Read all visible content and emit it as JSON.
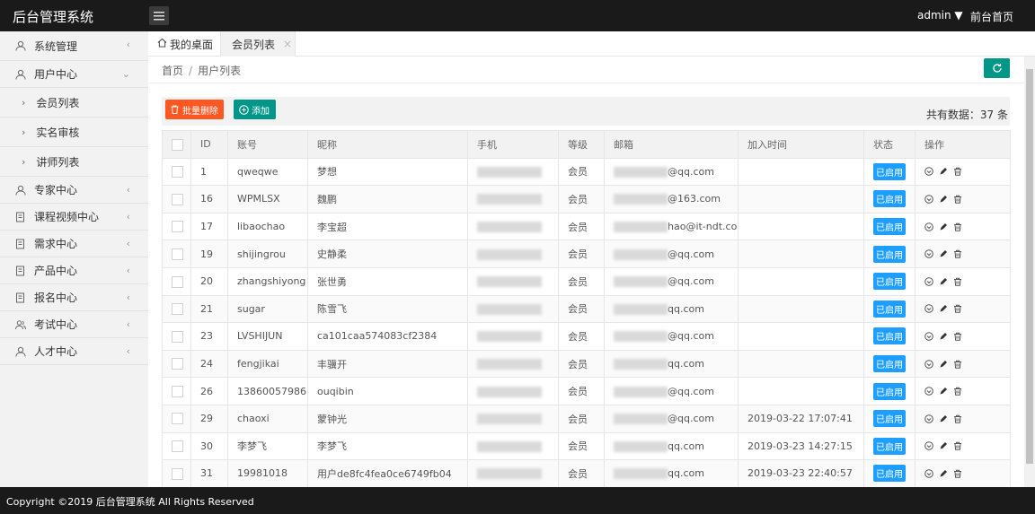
{
  "app": {
    "brand": "后台管理系统",
    "admin_label": "admin ▼",
    "front_link": "前台首页"
  },
  "sidebar": {
    "items": [
      {
        "label": "系统管理",
        "icon": "user-icon",
        "arrow": "‹"
      },
      {
        "label": "用户中心",
        "icon": "user-icon",
        "arrow": "⌄"
      },
      {
        "label": "专家中心",
        "icon": "user-icon",
        "arrow": "‹"
      },
      {
        "label": "课程视频中心",
        "icon": "document-icon",
        "arrow": "‹"
      },
      {
        "label": "需求中心",
        "icon": "document-icon",
        "arrow": "‹"
      },
      {
        "label": "产品中心",
        "icon": "document-icon",
        "arrow": "‹"
      },
      {
        "label": "报名中心",
        "icon": "document-icon",
        "arrow": "‹"
      },
      {
        "label": "考试中心",
        "icon": "users-icon",
        "arrow": "‹"
      },
      {
        "label": "人才中心",
        "icon": "user-icon",
        "arrow": "‹"
      }
    ],
    "subitems": [
      {
        "label": "会员列表"
      },
      {
        "label": "实名审核"
      },
      {
        "label": "讲师列表"
      }
    ]
  },
  "tabs": [
    {
      "label": "我的桌面",
      "icon": "home-icon"
    },
    {
      "label": "会员列表",
      "close": "×"
    }
  ],
  "breadcrumb": {
    "home": "首页",
    "sep": "/",
    "current": "用户列表"
  },
  "toolbar": {
    "delete_label": "批量删除",
    "add_label": "添加",
    "total_text": "共有数据：37 条"
  },
  "table": {
    "headers": [
      "",
      "ID",
      "账号",
      "昵称",
      "手机",
      "等级",
      "邮箱",
      "加入时间",
      "状态",
      "操作"
    ],
    "rows": [
      {
        "id": "1",
        "account": "qweqwe",
        "nickname": "梦想",
        "level": "会员",
        "email": "@qq.com",
        "joined": "",
        "status": "已启用"
      },
      {
        "id": "16",
        "account": "WPMLSX",
        "nickname": "魏鹏",
        "level": "会员",
        "email": "@163.com",
        "joined": "",
        "status": "已启用"
      },
      {
        "id": "17",
        "account": "libaochao",
        "nickname": "李宝超",
        "level": "会员",
        "email": "hao@it-ndt.com",
        "joined": "",
        "status": "已启用"
      },
      {
        "id": "19",
        "account": "shijingrou",
        "nickname": "史静柔",
        "level": "会员",
        "email": "@qq.com",
        "joined": "",
        "status": "已启用"
      },
      {
        "id": "20",
        "account": "zhangshiyong",
        "nickname": "张世勇",
        "level": "会员",
        "email": "@qq.com",
        "joined": "",
        "status": "已启用"
      },
      {
        "id": "21",
        "account": "sugar",
        "nickname": "陈雪飞",
        "level": "会员",
        "email": "qq.com",
        "joined": "",
        "status": "已启用"
      },
      {
        "id": "23",
        "account": "LVSHIJUN",
        "nickname": "ca101caa574083cf2384",
        "level": "会员",
        "email": "@qq.com",
        "joined": "",
        "status": "已启用"
      },
      {
        "id": "24",
        "account": "fengjikai",
        "nickname": "丰骥开",
        "level": "会员",
        "email": "qq.com",
        "joined": "",
        "status": "已启用"
      },
      {
        "id": "26",
        "account": "13860057986",
        "nickname": "ouqibin",
        "level": "会员",
        "email": "@qq.com",
        "joined": "",
        "status": "已启用"
      },
      {
        "id": "29",
        "account": "chaoxi",
        "nickname": "蒙钟光",
        "level": "会员",
        "email": "@qq.com",
        "joined": "2019-03-22 17:07:41",
        "status": "已启用"
      },
      {
        "id": "30",
        "account": "李梦飞",
        "nickname": "李梦飞",
        "level": "会员",
        "email": "qq.com",
        "joined": "2019-03-23 14:27:15",
        "status": "已启用"
      },
      {
        "id": "31",
        "account": "19981018",
        "nickname": "用户de8fc4fea0ce6749fb04",
        "level": "会员",
        "email": "qq.com",
        "joined": "2019-03-23 22:40:57",
        "status": "已启用"
      }
    ]
  },
  "footer": {
    "text": "Copyright ©2019 后台管理系统 All Rights Reserved"
  },
  "colors": {
    "topbar": "#1a1a1a",
    "primary": "#009688",
    "danger": "#ff5722",
    "badge": "#1e9fff"
  }
}
